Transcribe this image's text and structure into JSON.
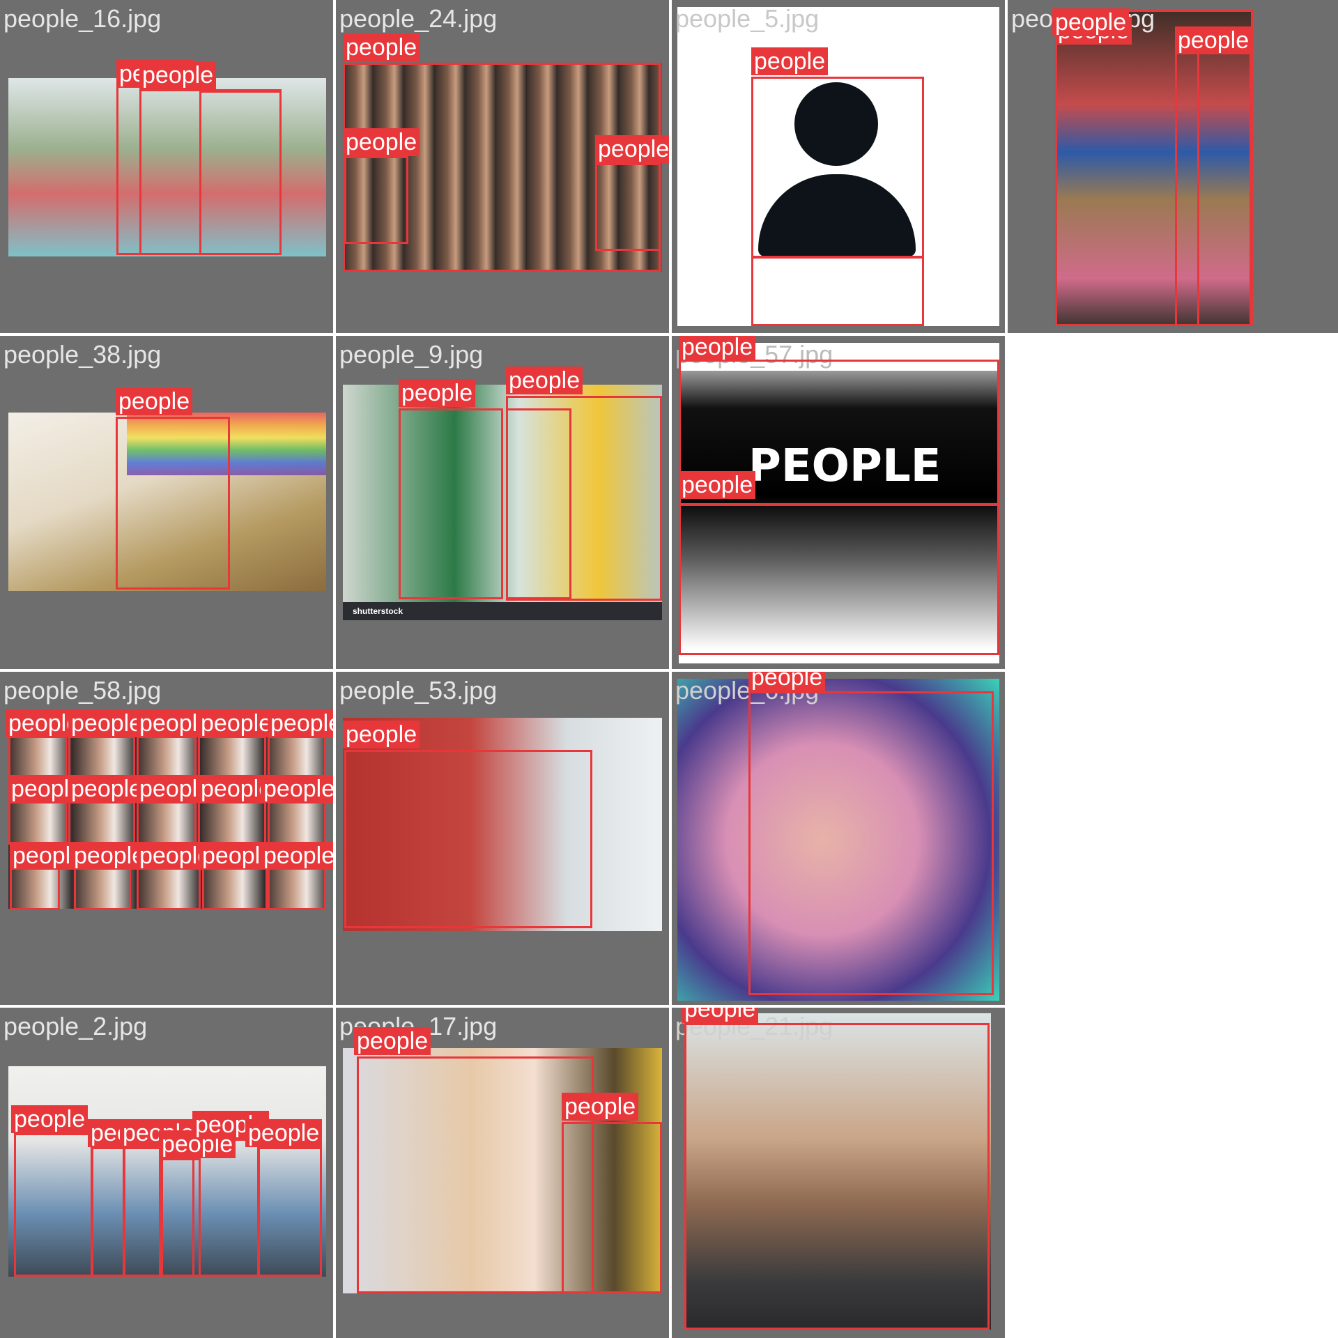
{
  "mosaic": {
    "tiles": [
      {
        "file": "people_16.jpg",
        "label": "people"
      },
      {
        "file": "people_24.jpg",
        "label": "people"
      },
      {
        "file": "people_5.jpg",
        "label": "people"
      },
      {
        "file": "people_1.jpg",
        "label": "people"
      },
      {
        "file": "people_38.jpg",
        "label": "people"
      },
      {
        "file": "people_9.jpg",
        "label": "people"
      },
      {
        "file": "people_57.jpg",
        "label": "people",
        "poster_text": "PEOPLE"
      },
      {
        "file": "people_58.jpg",
        "label": "people"
      },
      {
        "file": "people_53.jpg",
        "label": "people"
      },
      {
        "file": "people_6.jpg",
        "label": "people"
      },
      {
        "file": "people_2.jpg",
        "label": "people"
      },
      {
        "file": "people_17.jpg",
        "label": "people"
      },
      {
        "file": "people_21.jpg",
        "label": "people"
      }
    ],
    "colors": {
      "tile_bg": "#6e6e6e",
      "box": "#e8373b",
      "label_text": "#ffffff",
      "filename_text": "#e6e6e6"
    },
    "watermark": "shutterstock"
  }
}
